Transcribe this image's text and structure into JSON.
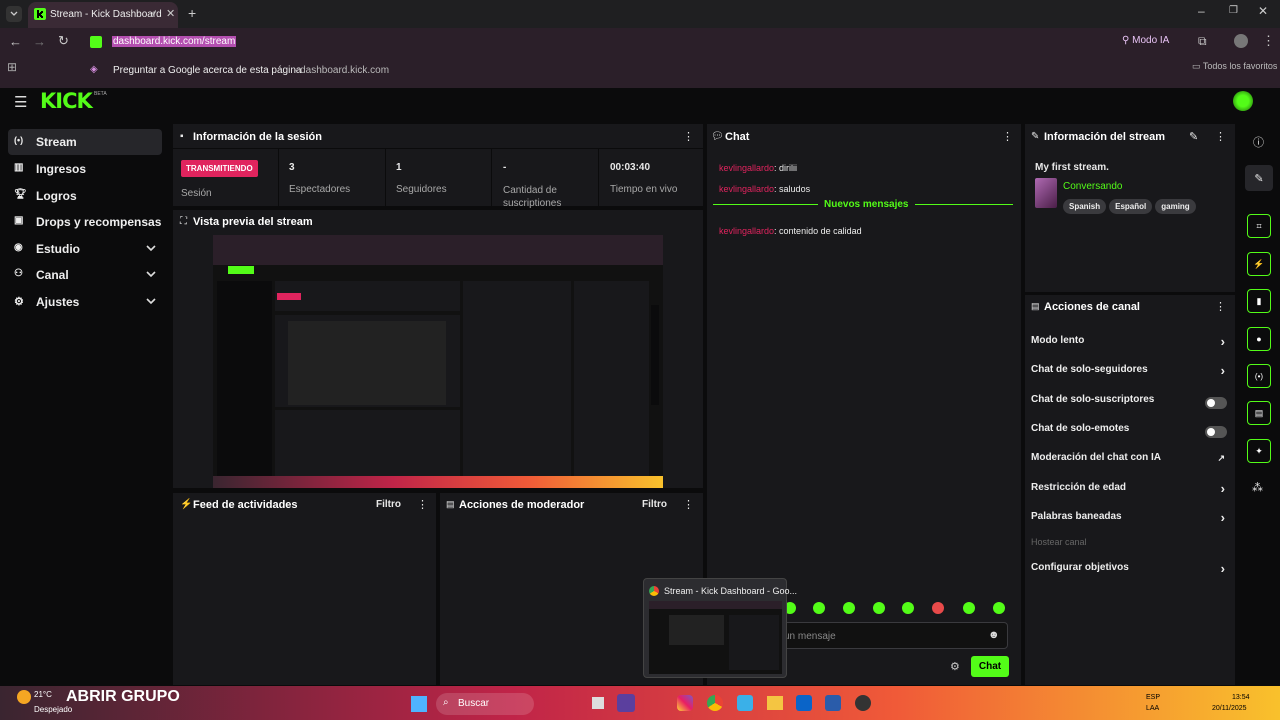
{
  "browser": {
    "tab_title": "Stream - Kick Dashboard",
    "url": "dashboard.kick.com/stream",
    "ai_mode": "Modo IA",
    "suggest": "Preguntar a Google acerca de esta página",
    "suggest_domain": "- dashboard.kick.com",
    "favorites": "Todos los favoritos"
  },
  "kick": {
    "logo": "KICK",
    "beta": "BETA"
  },
  "sidebar": {
    "items": [
      {
        "label": "Stream"
      },
      {
        "label": "Ingresos"
      },
      {
        "label": "Logros"
      },
      {
        "label": "Drops y recompensas"
      },
      {
        "label": "Estudio"
      },
      {
        "label": "Canal"
      },
      {
        "label": "Ajustes"
      }
    ]
  },
  "session": {
    "title": "Información de la sesión",
    "status": "TRANSMITIENDO",
    "status_label": "Sesión",
    "viewers": "3",
    "viewers_label": "Espectadores",
    "followers": "1",
    "followers_label": "Seguidores",
    "subs": "-",
    "subs_label": "Cantidad de suscriptiones",
    "uptime": "00:03:40",
    "uptime_label": "Tiempo en vivo"
  },
  "preview": {
    "title": "Vista previa del stream"
  },
  "feed": {
    "title": "Feed de actividades",
    "filter": "Filtro"
  },
  "mod_actions": {
    "title": "Acciones de moderador",
    "filter": "Filtro"
  },
  "chat": {
    "title": "Chat",
    "messages": [
      {
        "user": "kevlingallardo",
        "text": ": dirilii"
      },
      {
        "user": "kevlingallardo",
        "text": ": saludos"
      }
    ],
    "new_messages": "Nuevos mensajes",
    "messages_after": [
      {
        "user": "kevlingallardo",
        "text": ": contenido de calidad"
      }
    ],
    "input_placeholder": "un mensaje",
    "send": "Chat"
  },
  "stream_info": {
    "title": "Información del stream",
    "stream_title": "My first stream.",
    "category": "Conversando",
    "tags": [
      "Spanish",
      "Español",
      "gaming"
    ]
  },
  "channel_actions": {
    "title": "Acciones de canal",
    "items": [
      {
        "label": "Modo lento",
        "kind": "chevron"
      },
      {
        "label": "Chat de solo-seguidores",
        "kind": "chevron"
      },
      {
        "label": "Chat de solo-suscriptores",
        "kind": "toggle"
      },
      {
        "label": "Chat de solo-emotes",
        "kind": "toggle"
      },
      {
        "label": "Moderación del chat con IA",
        "kind": "external"
      },
      {
        "label": "Restricción de edad",
        "kind": "chevron"
      },
      {
        "label": "Palabras baneadas",
        "kind": "chevron"
      },
      {
        "label": "Hostear canal",
        "kind": "disabled"
      },
      {
        "label": "Configurar objetivos",
        "kind": "chevron"
      }
    ]
  },
  "tooltip": {
    "title": "Stream - Kick Dashboard - Goo..."
  },
  "taskbar": {
    "weather_temp": "21°C",
    "weather_desc": "Despejado",
    "group": "ABRIR GRUPO",
    "search": "Buscar",
    "lang": "ESP",
    "lang2": "LAA",
    "time": "13:54",
    "date": "20/11/2025"
  },
  "colors": {
    "accent": "#53fc18",
    "live": "#e0245e",
    "panel": "#18181b",
    "bg": "#0b0b0c"
  }
}
